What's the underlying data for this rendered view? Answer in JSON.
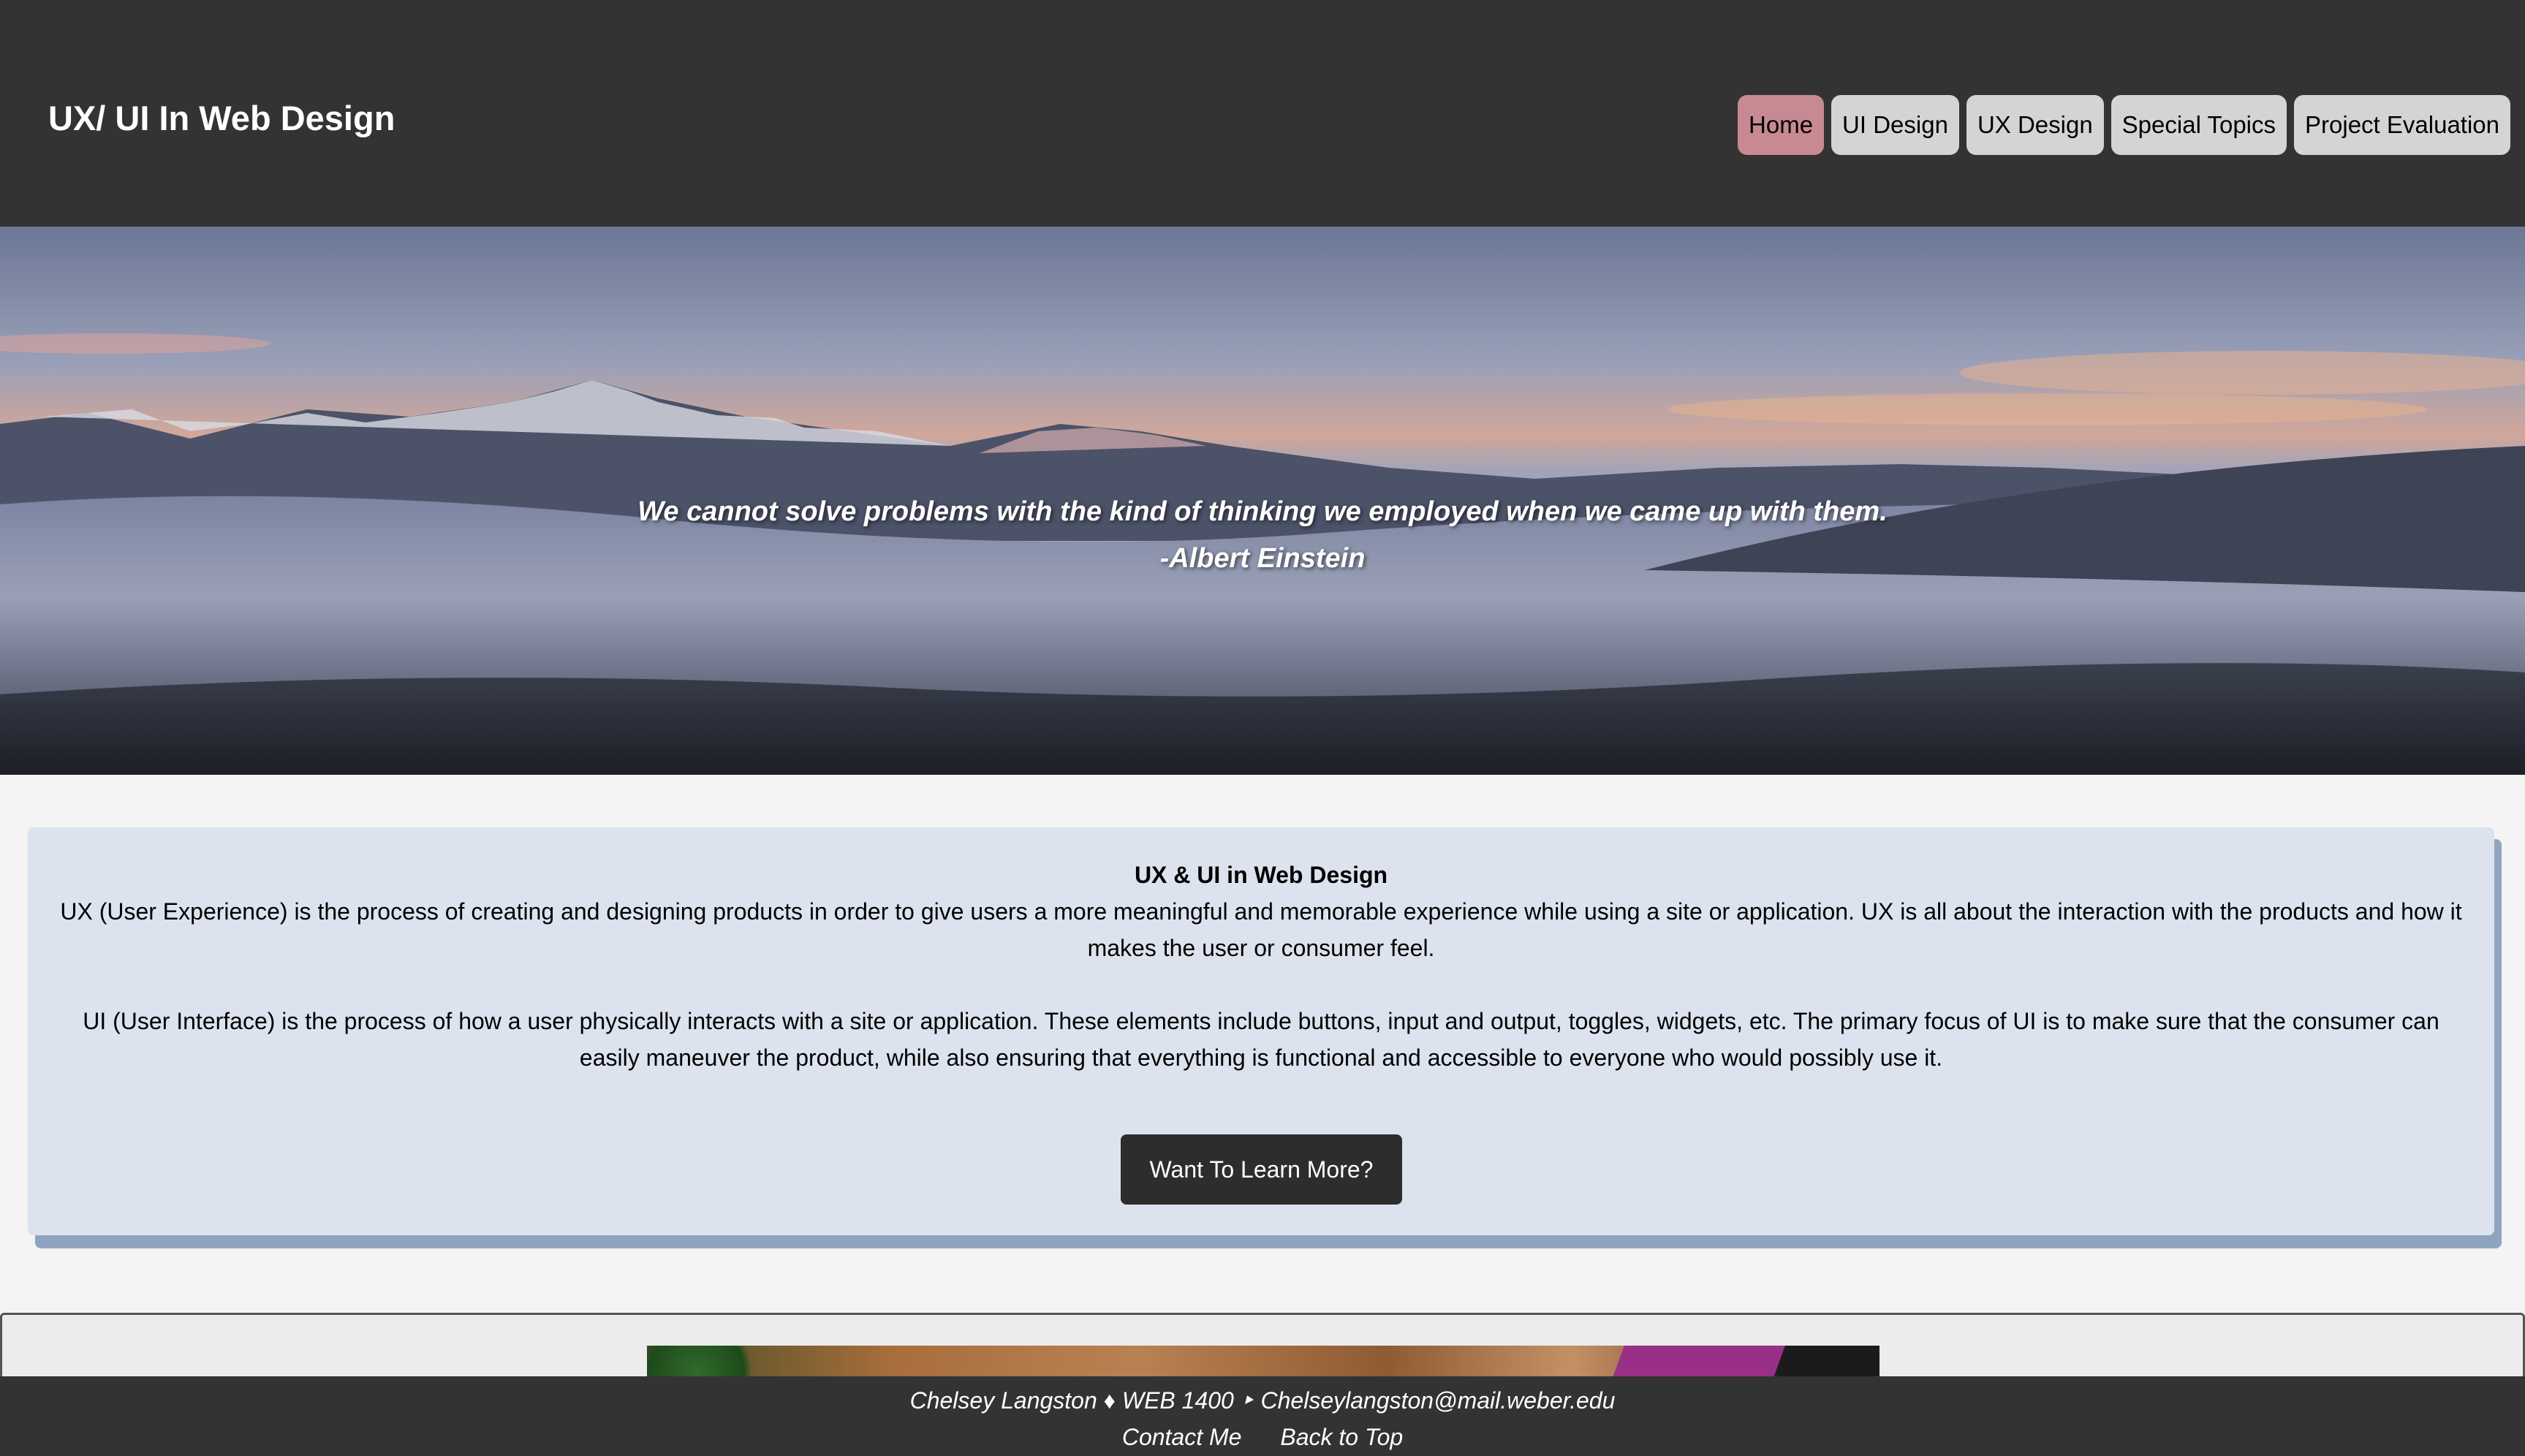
{
  "header": {
    "title": "UX/ UI In Web Design",
    "nav": [
      {
        "label": "Home",
        "active": true
      },
      {
        "label": "UI Design",
        "active": false
      },
      {
        "label": "UX Design",
        "active": false
      },
      {
        "label": "Special Topics",
        "active": false
      },
      {
        "label": "Project Evaluation",
        "active": false
      }
    ]
  },
  "hero": {
    "quote": "We cannot solve problems with the kind of thinking we employed when we came up with them.",
    "author": "-Albert Einstein"
  },
  "intro": {
    "title": "UX & UI in Web Design",
    "ux_paragraph": "UX (User Experience) is the process of creating and designing products in order to give users a more meaningful and memorable experience while using a site or application. UX is all about the interaction with the products and how it makes the user or consumer feel.",
    "ui_paragraph": "UI (User Interface) is the process of how a user physically interacts with a site or application. These elements include buttons, input and output, toggles, widgets, etc. The primary focus of UI is to make sure that the consumer can easily maneuver the product, while also ensuring that everything is functional and accessible to everyone who would possibly use it.",
    "button_label": "Want To Learn More?"
  },
  "footer": {
    "info": "Chelsey Langston  ♦  WEB 1400 ‣ Chelseylangston@mail.weber.edu",
    "contact_label": "Contact Me",
    "top_label": "Back to Top"
  },
  "colors": {
    "header_bg": "#333333",
    "active_nav": "#c88a92",
    "nav_bg": "#d4d4d4",
    "card_bg": "#dce3ee",
    "card_shadow": "#8fa5bf",
    "button_bg": "#2d2d2d"
  }
}
